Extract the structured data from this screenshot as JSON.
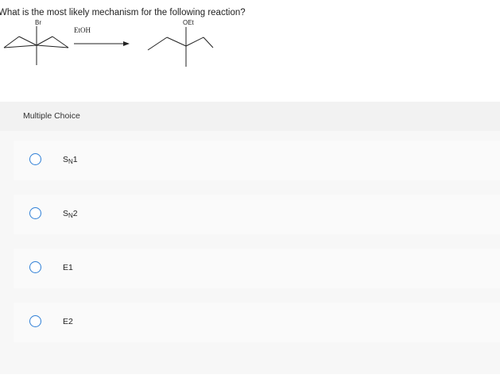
{
  "question": {
    "text": "What is the most likely mechanism for the following reaction?"
  },
  "reaction": {
    "reactant_substituent": "Br",
    "reagent": "EtOH",
    "product_substituent": "OEt"
  },
  "multiple_choice": {
    "header": "Multiple Choice",
    "accent_color": "#2f7fd6",
    "options": [
      {
        "main": "S",
        "sub": "N",
        "num": "1"
      },
      {
        "main": "S",
        "sub": "N",
        "num": "2"
      },
      {
        "main": "E",
        "sub": "",
        "num": "1"
      },
      {
        "main": "E",
        "sub": "",
        "num": "2"
      }
    ]
  }
}
